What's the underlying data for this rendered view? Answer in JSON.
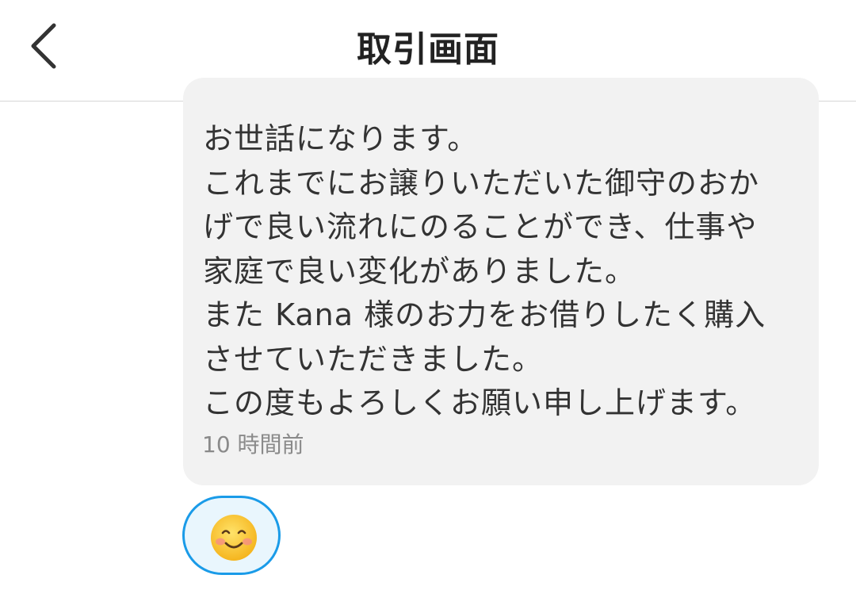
{
  "header": {
    "title": "取引画面",
    "back_icon": "chevron-left-icon"
  },
  "message": {
    "lines": [
      "お世話になります。",
      "これまでにお譲りいただいた御守のおか",
      "げで良い流れにのることができ、仕事や",
      "家庭で良い変化がありました。",
      "また Kana 様のお力をお借りしたく購入",
      "させていただきました。",
      "この度もよろしくお願い申し上げます。"
    ],
    "timestamp": "10 時間前"
  },
  "reaction": {
    "icon": "smiling-face-icon"
  },
  "colors": {
    "bubble_background": "#f2f2f2",
    "reaction_border": "#1a9be8",
    "reaction_background": "#e9f6fd",
    "text": "#333333",
    "timestamp": "#8a8a8a"
  }
}
